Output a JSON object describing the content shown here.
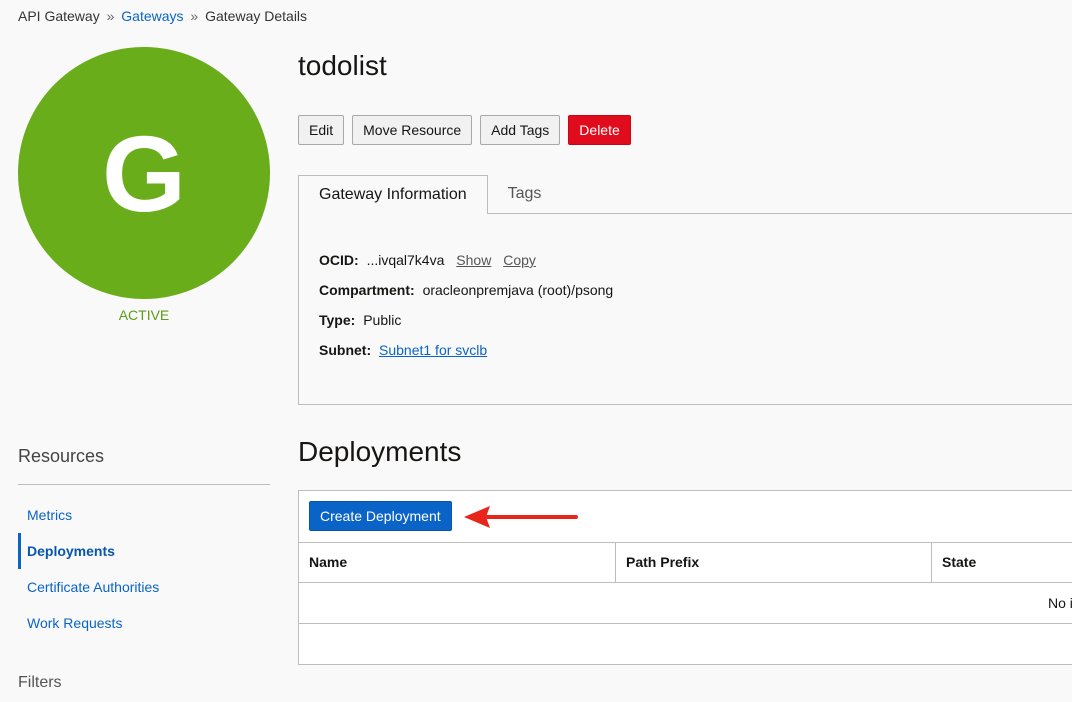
{
  "breadcrumb": {
    "root": "API Gateway",
    "separator": "»",
    "gateways_link": "Gateways",
    "current": "Gateway Details"
  },
  "resource": {
    "avatar_letter": "G",
    "status": "ACTIVE",
    "title": "todolist"
  },
  "actions": {
    "edit": "Edit",
    "move_resource": "Move Resource",
    "add_tags": "Add Tags",
    "delete": "Delete"
  },
  "tabs": [
    {
      "label": "Gateway Information",
      "active": true
    },
    {
      "label": "Tags",
      "active": false
    }
  ],
  "gateway_info": {
    "ocid_label": "OCID:",
    "ocid_value": "...ivqal7k4va",
    "show_link": "Show",
    "copy_link": "Copy",
    "compartment_label": "Compartment:",
    "compartment_value": "oracleonpremjava (root)/psong",
    "type_label": "Type:",
    "type_value": "Public",
    "subnet_label": "Subnet:",
    "subnet_value": "Subnet1 for svclb"
  },
  "sidebar": {
    "resources_title": "Resources",
    "items": [
      {
        "label": "Metrics",
        "active": false
      },
      {
        "label": "Deployments",
        "active": true
      },
      {
        "label": "Certificate Authorities",
        "active": false
      },
      {
        "label": "Work Requests",
        "active": false
      }
    ],
    "filters_title": "Filters"
  },
  "deployments": {
    "title": "Deployments",
    "create_button": "Create Deployment",
    "columns": [
      "Name",
      "Path Prefix",
      "State"
    ],
    "empty_text": "No i"
  },
  "colors": {
    "avatar": "#6aad1a",
    "primary": "#0a64c8",
    "danger": "#e00b1c",
    "annotation_arrow": "#e8251b"
  }
}
